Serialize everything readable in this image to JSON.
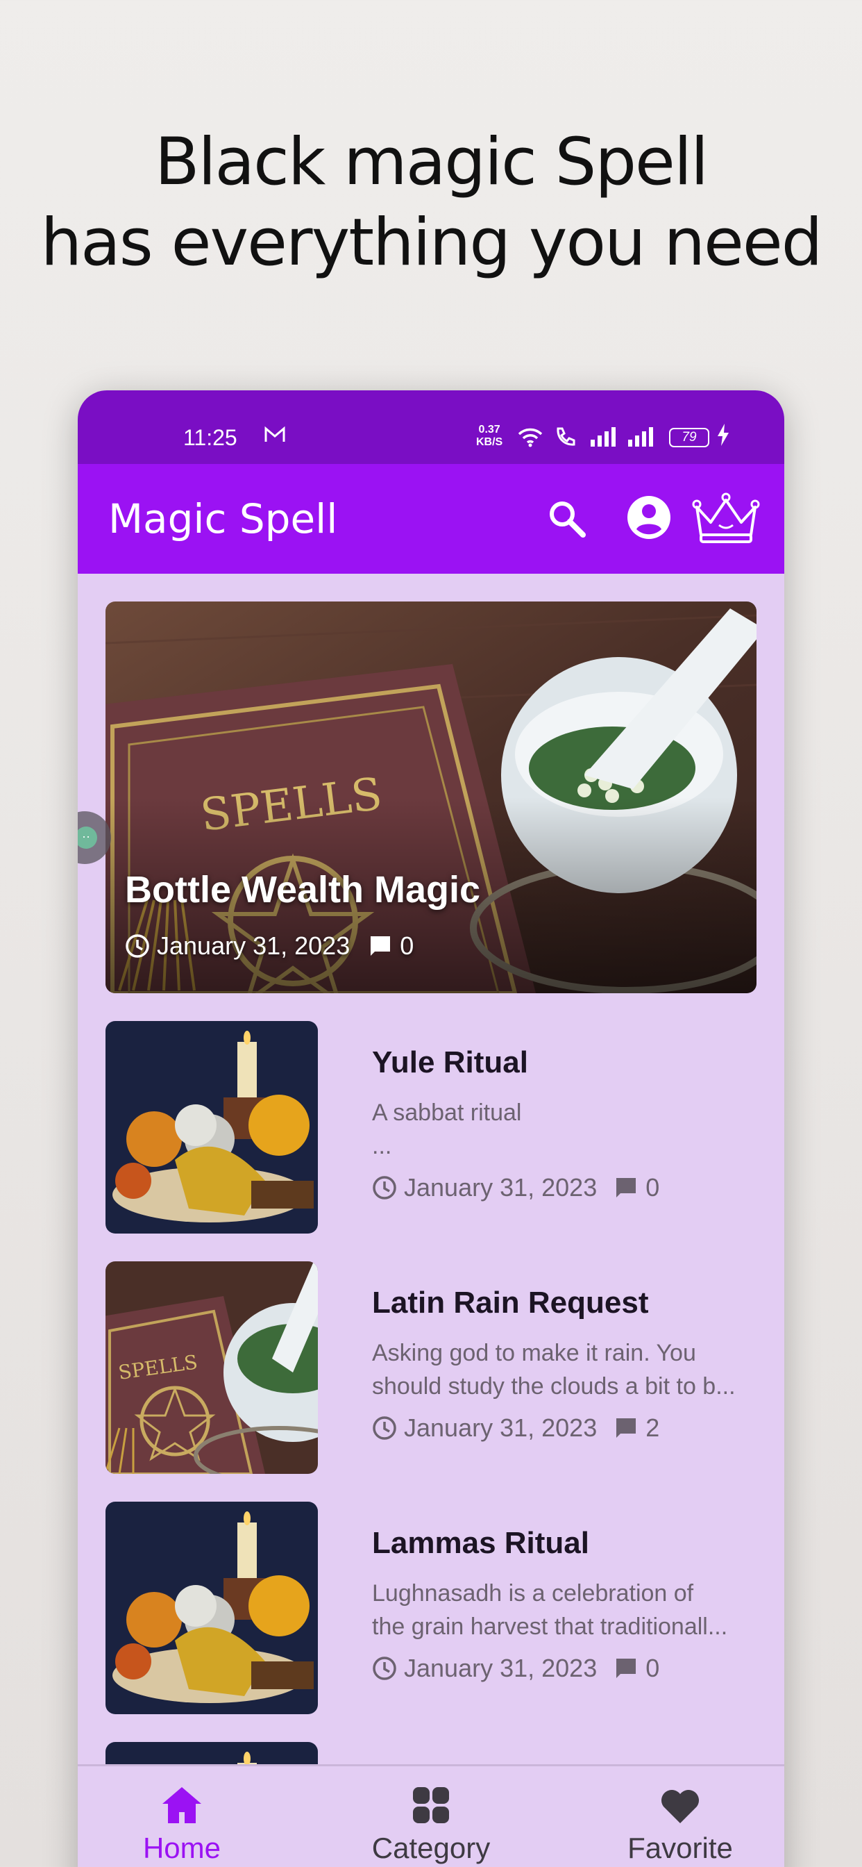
{
  "promo": {
    "line1": "Black magic Spell",
    "line2": "has everything you need"
  },
  "status_bar": {
    "time": "11:25",
    "net_speed_value": "0.37",
    "net_speed_unit": "KB/S",
    "battery": "79",
    "icons": [
      "gmail-icon",
      "wifi-icon",
      "wifi-calling-icon",
      "signal-icon",
      "signal-icon",
      "battery-icon",
      "charging-icon"
    ]
  },
  "app_bar": {
    "title": "Magic Spell",
    "icons": [
      "search-icon",
      "account-icon",
      "crown-icon"
    ]
  },
  "featured": {
    "title": "Bottle Wealth Magic",
    "date": "January 31, 2023",
    "comments": "0"
  },
  "posts": [
    {
      "title": "Yule Ritual",
      "desc_line1": "A sabbat ritual",
      "desc_line2": "...",
      "date": "January 31, 2023",
      "comments": "0"
    },
    {
      "title": "Latin Rain Request",
      "desc_line1": "Asking god to make it rain. You",
      "desc_line2": "should study the clouds a bit to b...",
      "date": "January 31, 2023",
      "comments": "2"
    },
    {
      "title": "Lammas Ritual",
      "desc_line1": "Lughnasadh is a celebration of",
      "desc_line2": "the grain harvest that traditionall...",
      "date": "January 31, 2023",
      "comments": "0"
    }
  ],
  "bottom_nav": {
    "items": [
      {
        "label": "Home",
        "icon": "home-icon",
        "active": true
      },
      {
        "label": "Category",
        "icon": "grid-icon",
        "active": false
      },
      {
        "label": "Favorite",
        "icon": "heart-icon",
        "active": false
      }
    ]
  },
  "colors": {
    "status_bar": "#7a0ec4",
    "app_bar": "#9b12f3",
    "background": "#e3cdf3",
    "active_nav": "#9b12f3"
  }
}
